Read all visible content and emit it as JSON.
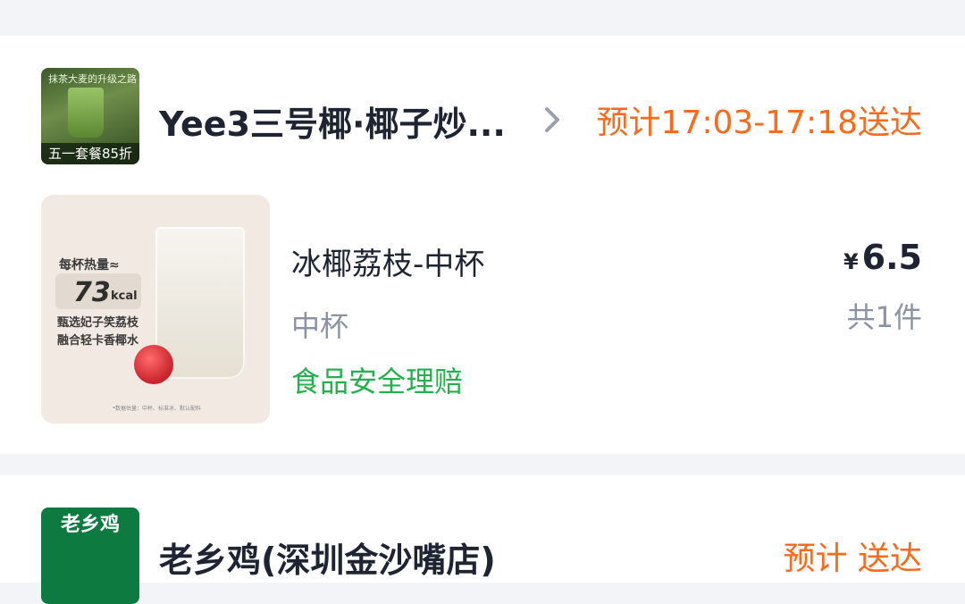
{
  "orders": [
    {
      "shop": {
        "name": "Yee3三号椰·椰子炒...",
        "thumb_banner": "五一套餐85折",
        "thumb_caption": "抹茶大麦的升级之路"
      },
      "eta": "预计17:03-17:18送达",
      "item": {
        "name": "冰椰荔枝-中杯",
        "spec": "中杯",
        "guarantee": "食品安全理赔",
        "price_symbol": "¥",
        "price": "6.5",
        "quantity": "共1件",
        "image": {
          "cal_label": "每杯热量≈",
          "cal_value": "73",
          "cal_unit": "kcal",
          "line1": "甄选妃子笑荔枝",
          "line2": "融合轻卡香椰水",
          "disclaimer": "*数据估量：中杯、标准冰、默认配料"
        }
      }
    },
    {
      "shop": {
        "name": "老乡鸡(深圳金沙嘴店)",
        "thumb_banner": "老乡鸡"
      },
      "eta": "预计 送达"
    }
  ],
  "colors": {
    "accent_orange": "#ff6a1a",
    "guarantee_green": "#23b14d",
    "muted_gray": "#8a93a3",
    "text_dark": "#1f2433",
    "background": "#f2f4f7"
  }
}
